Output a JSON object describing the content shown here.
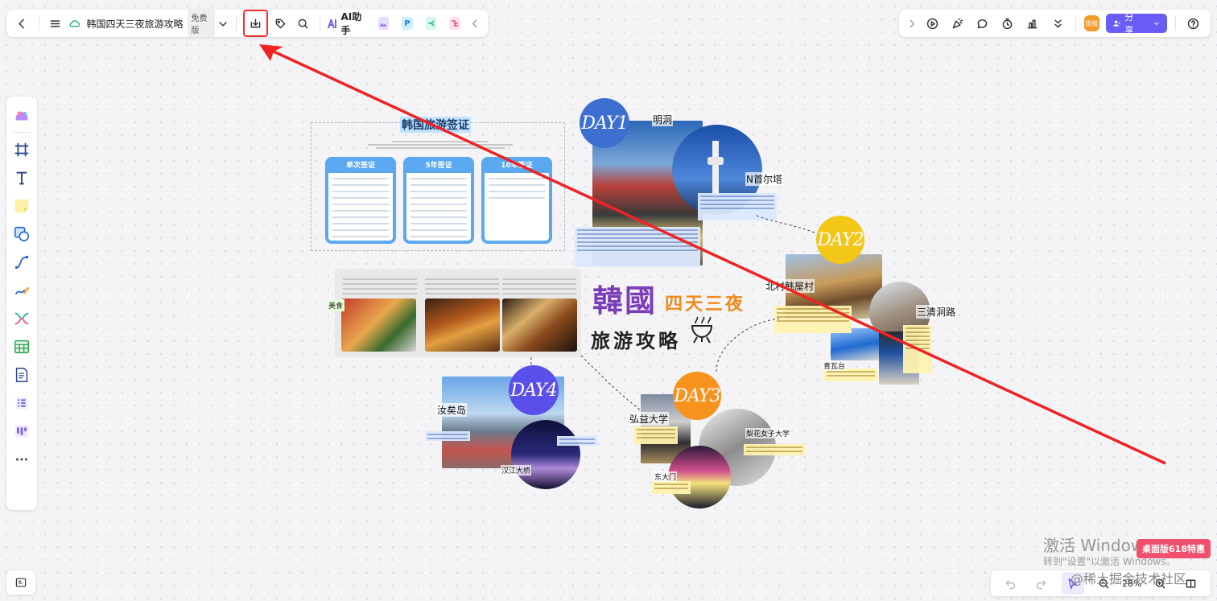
{
  "toolbar": {
    "doc_title": "韩国四天三夜旅游攻略",
    "plan_badge": "免费版",
    "ai_label": "AI助手",
    "plugin_p": "P"
  },
  "right_toolbar": {
    "avatar_text": "思维",
    "share_label": "分享"
  },
  "zoom": {
    "level": "28%"
  },
  "canvas": {
    "visa": {
      "title": "韩国旅游签证",
      "cards": [
        "单次签证",
        "5年签证",
        "10年签证"
      ]
    },
    "food_label": "美食",
    "main_title": {
      "han": "韓國",
      "days": "四天三夜",
      "guide": "旅游攻略"
    },
    "days": [
      "DAY1",
      "DAY2",
      "DAY3",
      "DAY4"
    ],
    "places": {
      "myeongdong": "明洞",
      "ntower": "N首尔塔",
      "bukchon": "北村韩屋村",
      "samcheong": "三清洞路",
      "bluehouse": "青瓦台",
      "hongdae": "弘益大学",
      "ewha": "梨花女子大学",
      "dongdaemun": "东大门",
      "yeouido": "汝矣岛",
      "hanriver": "汉江大桥"
    }
  },
  "watermark": {
    "line1": "激活 Window",
    "line2": "转到\"设置\"以激活 Windows。",
    "community": "@稀土掘金技术社区"
  },
  "promo": "桌面版618特惠",
  "colors": {
    "accent": "#6b5cf6",
    "highlight_red": "#ff2a2a",
    "day1": "#3c6fd0",
    "day2": "#f2c718",
    "day3": "#f5931e",
    "day4": "#5a4fe8"
  }
}
